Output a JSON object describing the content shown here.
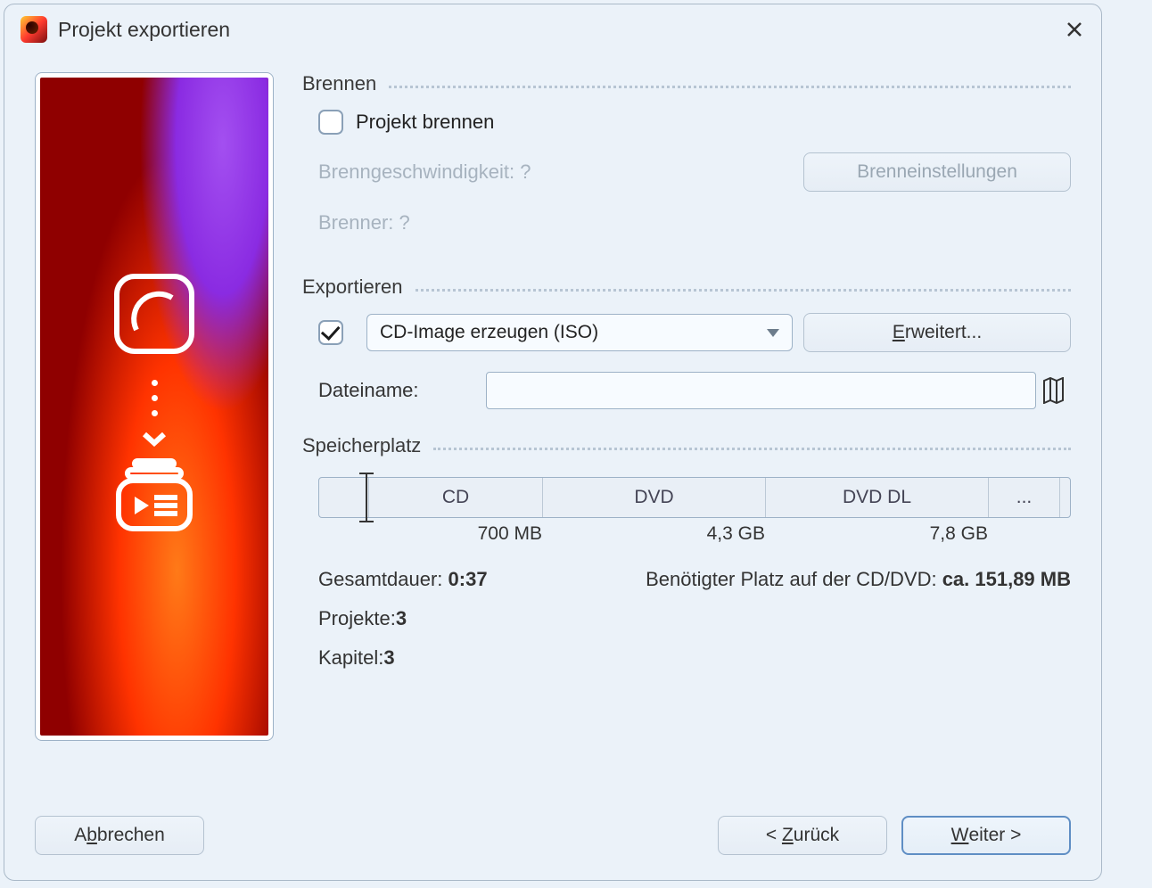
{
  "window": {
    "title": "Projekt exportieren"
  },
  "sections": {
    "burn": {
      "header": "Brennen",
      "checkbox_label": "Projekt brennen",
      "checked": false,
      "speed_label": "Brenngeschwindigkeit: ?",
      "burner_label": "Brenner: ?",
      "settings_button": "Brenneinstellungen"
    },
    "export": {
      "header": "Exportieren",
      "checked": true,
      "format_selected": "CD-Image erzeugen (ISO)",
      "advanced_button": "Erweitert...",
      "filename_label": "Dateiname:",
      "filename_value": ""
    },
    "storage": {
      "header": "Speicherplatz",
      "segments": {
        "cd": "CD",
        "dvd": "DVD",
        "dvddl": "DVD DL",
        "more": "..."
      },
      "ticks": {
        "cd": "700 MB",
        "dvd": "4,3 GB",
        "dvddl": "7,8 GB"
      },
      "duration_label": "Gesamtdauer: ",
      "duration_value": "0:37",
      "required_label": "Benötigter Platz auf der CD/DVD: ",
      "required_value": "ca. 151,89 MB",
      "projects_label": "Projekte: ",
      "projects_value": "3",
      "chapters_label": "Kapitel: ",
      "chapters_value": "3"
    }
  },
  "buttons": {
    "cancel": "Abbrechen",
    "back": "< Zurück",
    "next": "Weiter >"
  }
}
